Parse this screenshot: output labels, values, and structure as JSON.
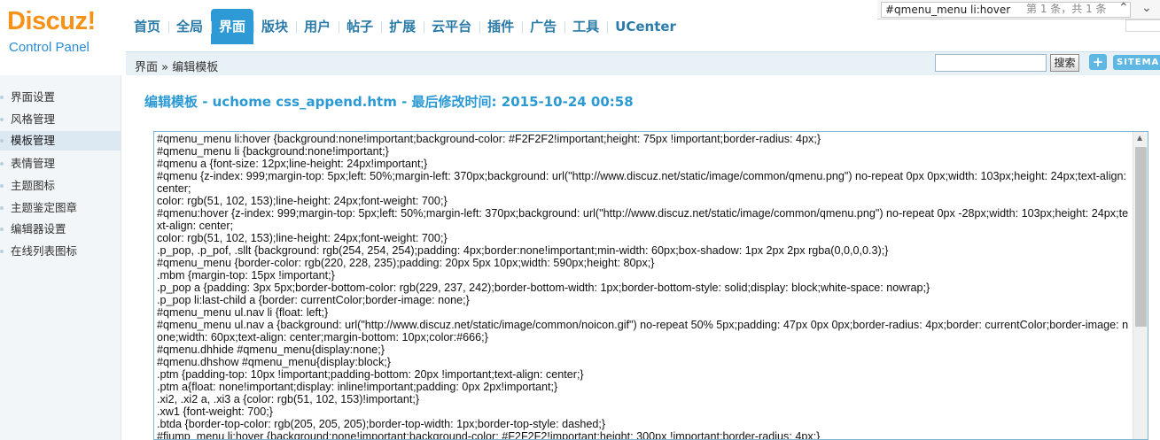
{
  "logo": {
    "brand": "Discuz!",
    "sub": "Control Panel"
  },
  "nav": {
    "items": [
      {
        "label": "首页"
      },
      {
        "label": "全局"
      },
      {
        "label": "界面"
      },
      {
        "label": "版块"
      },
      {
        "label": "用户"
      },
      {
        "label": "帖子"
      },
      {
        "label": "扩展"
      },
      {
        "label": "云平台"
      },
      {
        "label": "插件"
      },
      {
        "label": "广告"
      },
      {
        "label": "工具"
      },
      {
        "label": "UCenter"
      }
    ],
    "active_index": 2
  },
  "findbar": {
    "query": "#qmenu_menu li:hover",
    "count": "第 1 条，共 1 条",
    "up_icon": "chevron-up-icon",
    "down_icon": "chevron-down-icon"
  },
  "breadcrumb": "界面 » 编辑模板",
  "search": {
    "button": "搜索",
    "plus": "+",
    "sitemap": "SITEMAP"
  },
  "sidebar": {
    "items": [
      {
        "label": "界面设置"
      },
      {
        "label": "风格管理"
      },
      {
        "label": "模板管理"
      },
      {
        "label": "表情管理"
      },
      {
        "label": "主题图标"
      },
      {
        "label": "主题鉴定图章"
      },
      {
        "label": "编辑器设置"
      },
      {
        "label": "在线列表图标"
      }
    ],
    "active_index": 2
  },
  "page_title": "编辑模板 - uchome css_append.htm - 最后修改时间: 2015-10-24 00:58",
  "editor": {
    "content": "#qmenu_menu li:hover {background:none!important;background-color: #F2F2F2!important;height: 75px !important;border-radius: 4px;}\n#qmenu_menu li {background:none!important;}\n#qmenu a {font-size: 12px;line-height: 24px!important;}\n#qmenu {z-index: 999;margin-top: 5px;left: 50%;margin-left: 370px;background: url(\"http://www.discuz.net/static/image/common/qmenu.png\") no-repeat 0px 0px;width: 103px;height: 24px;text-align: center;\ncolor: rgb(51, 102, 153);line-height: 24px;font-weight: 700;}\n#qmenu:hover {z-index: 999;margin-top: 5px;left: 50%;margin-left: 370px;background: url(\"http://www.discuz.net/static/image/common/qmenu.png\") no-repeat 0px -28px;width: 103px;height: 24px;text-align: center;\ncolor: rgb(51, 102, 153);line-height: 24px;font-weight: 700;}\n.p_pop, .p_pof, .sllt {background: rgb(254, 254, 254);padding: 4px;border:none!important;min-width: 60px;box-shadow: 1px 2px 2px rgba(0,0,0,0.3);}\n#qmenu_menu {border-color: rgb(220, 228, 235);padding: 20px 5px 10px;width: 590px;height: 80px;}\n.mbm {margin-top: 15px !important;}\n.p_pop a {padding: 3px 5px;border-bottom-color: rgb(229, 237, 242);border-bottom-width: 1px;border-bottom-style: solid;display: block;white-space: nowrap;}\n.p_pop li:last-child a {border: currentColor;border-image: none;}\n#qmenu_menu ul.nav li {float: left;}\n#qmenu_menu ul.nav a {background: url(\"http://www.discuz.net/static/image/common/noicon.gif\") no-repeat 50% 5px;padding: 47px 0px 0px;border-radius: 4px;border: currentColor;border-image: none;width: 60px;text-align: center;margin-bottom: 10px;color:#666;}\n#qmenu.dhhide #qmenu_menu{display:none;}\n#qmenu.dhshow #qmenu_menu{display:block;}\n.ptm {padding-top: 10px !important;padding-bottom: 20px !important;text-align: center;}\n.ptm a{float: none!important;display: inline!important;padding: 0px 2px!important;}\n.xi2, .xi2 a, .xi3 a {color: rgb(51, 102, 153)!important;}\n.xw1 {font-weight: 700;}\n.btda {border-top-color: rgb(205, 205, 205);border-top-width: 1px;border-top-style: dashed;}\n#fjump_menu li:hover {background:none!important;background-color: #F2F2F2!important;height: 300px !important;border-radius: 4px;}"
  }
}
